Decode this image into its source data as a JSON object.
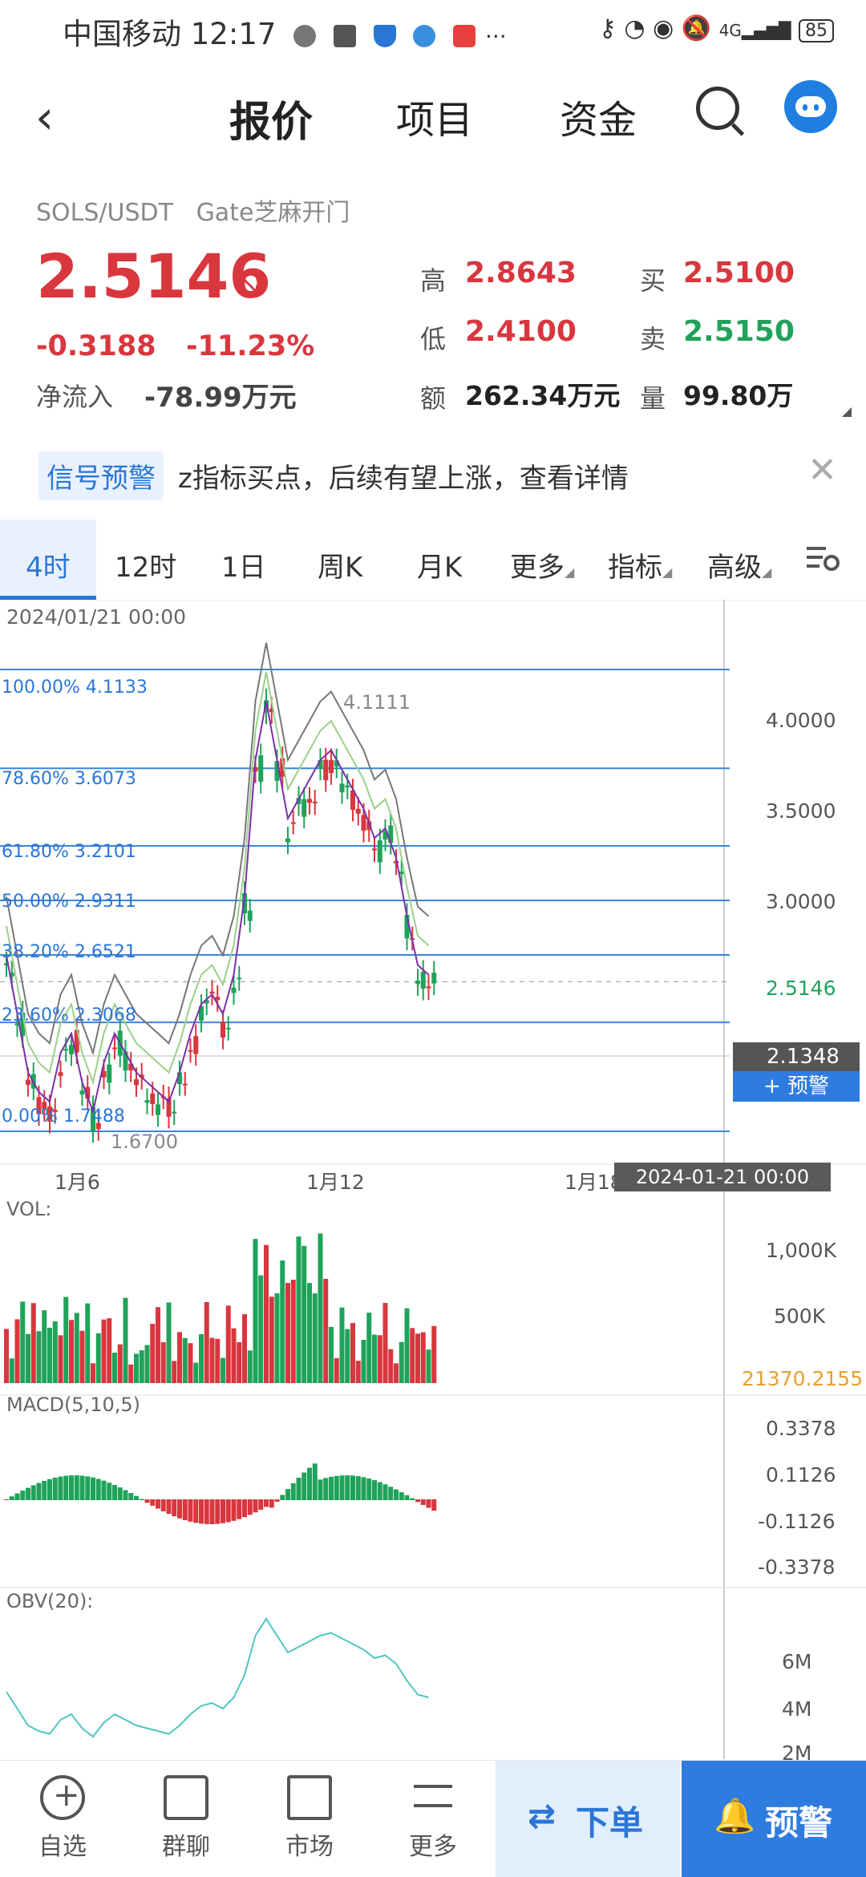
{
  "status_bar": {
    "carrier": "中国移动",
    "time": "12:17",
    "battery": "85"
  },
  "nav": {
    "tabs": [
      "报价",
      "项目",
      "资金"
    ],
    "active": "报价"
  },
  "ticker": {
    "pair": "SOLS/USDT",
    "exchange": "Gate芝麻开门",
    "price": "2.5146",
    "change": "-0.3188",
    "change_pct": "-11.23%",
    "net_inflow_label": "净流入",
    "net_inflow": "-78.99万元"
  },
  "stats": [
    {
      "label": "高",
      "value": "2.8643",
      "color": "red"
    },
    {
      "label": "买",
      "value": "2.5100",
      "color": "red"
    },
    {
      "label": "低",
      "value": "2.4100",
      "color": "red"
    },
    {
      "label": "卖",
      "value": "2.5150",
      "color": "green"
    },
    {
      "label": "额",
      "value": "262.34万元",
      "color": "dark"
    },
    {
      "label": "量",
      "value": "99.80万",
      "color": "dark"
    }
  ],
  "signal": {
    "tag": "信号预警",
    "text": "z指标买点，后续有望上涨，查看详情"
  },
  "periods": [
    "4时",
    "12时",
    "1日",
    "周K",
    "月K",
    "更多",
    "指标",
    "高级"
  ],
  "active_period": "4时",
  "chart": {
    "timestamp_top": "2024/01/21 00:00",
    "price_axis": [
      "4.0000",
      "3.5000",
      "3.0000"
    ],
    "current_price_label": "2.5146",
    "crosshair_price": "2.1348",
    "alert_button": "+ 预警",
    "fib_levels": [
      {
        "label": "100.00% 4.1133",
        "v": 4.1133
      },
      {
        "label": "78.60% 3.6073",
        "v": 3.6073
      },
      {
        "label": "61.80% 3.2101",
        "v": 3.2101
      },
      {
        "label": "50.00% 2.9311",
        "v": 2.9311
      },
      {
        "label": "38.20% 2.6521",
        "v": 2.6521
      },
      {
        "label": "23.60% 2.3068",
        "v": 2.3068
      },
      {
        "label": "0.00% 1.7488",
        "v": 1.7488
      }
    ],
    "high_label": "4.1111",
    "low_label": "1.6700",
    "x_labels": [
      "1月6",
      "1月12",
      "1月18"
    ],
    "crosshair_time": "2024-01-21 00:00",
    "vol": {
      "title": "VOL:",
      "axis": [
        "1,000K",
        "500K"
      ],
      "value": "21370.2155"
    },
    "macd": {
      "title": "MACD(5,10,5)",
      "axis": [
        "0.3378",
        "0.1126",
        "-0.1126",
        "-0.3378"
      ]
    },
    "obv": {
      "title": "OBV(20):",
      "axis": [
        "6M",
        "4M",
        "2M"
      ]
    }
  },
  "bottom_nav": [
    {
      "label": "自选",
      "icon": "add-circle-icon"
    },
    {
      "label": "群聊",
      "icon": "chat-icon"
    },
    {
      "label": "市场",
      "icon": "monitor-chart-icon"
    },
    {
      "label": "更多",
      "icon": "sliders-icon"
    }
  ],
  "order_button": "下单",
  "alert_button": "预警"
}
